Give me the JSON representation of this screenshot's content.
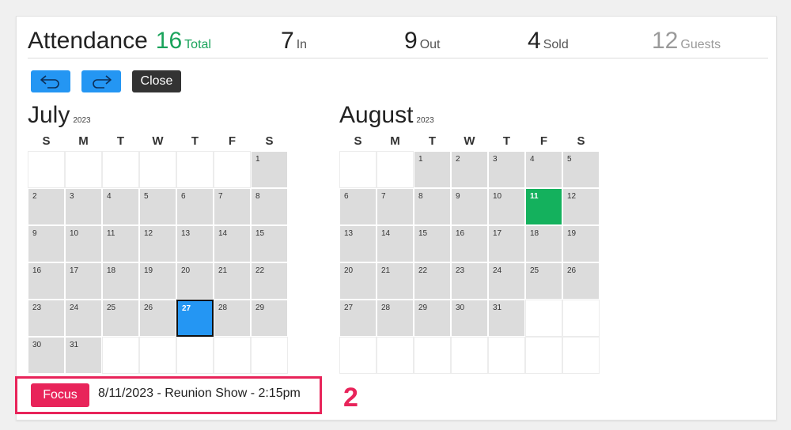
{
  "header": {
    "title": "Attendance",
    "stats": [
      {
        "value": "16",
        "label": "Total"
      },
      {
        "value": "7",
        "label": "In"
      },
      {
        "value": "9",
        "label": "Out"
      },
      {
        "value": "4",
        "label": "Sold"
      },
      {
        "value": "12",
        "label": "Guests"
      }
    ]
  },
  "toolbar": {
    "undo_icon": "undo-arrow-icon",
    "redo_icon": "redo-arrow-icon",
    "close_label": "Close",
    "accent_color": "#2496f3"
  },
  "calendar": {
    "weekdays": [
      "S",
      "M",
      "T",
      "W",
      "T",
      "F",
      "S"
    ],
    "months": [
      {
        "name": "July",
        "year": "2023",
        "first_weekday": 6,
        "days": 31,
        "selected_day": 27,
        "selected_color": "#2496f3"
      },
      {
        "name": "August",
        "year": "2023",
        "first_weekday": 2,
        "days": 31,
        "selected_day": 11,
        "selected_color": "#14b15d"
      }
    ]
  },
  "focus": {
    "button_label": "Focus",
    "text": "8/11/2023 - Reunion Show - 2:15pm",
    "highlight_color": "#e8245a"
  },
  "annotation": {
    "step": "2"
  }
}
